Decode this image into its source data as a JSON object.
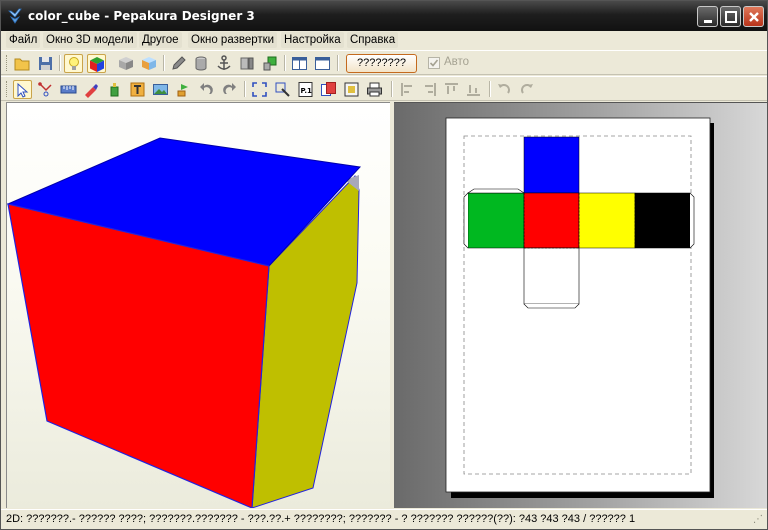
{
  "window": {
    "title": "color_cube - Pepakura Designer 3",
    "app_icon": "pepakura-logo-icon"
  },
  "menu": [
    {
      "label": "Файл"
    },
    {
      "label": "Окно 3D модели"
    },
    {
      "label": "Другое"
    },
    {
      "label": "Окно развертки"
    },
    {
      "label": "Настройка"
    },
    {
      "label": "Справка"
    }
  ],
  "toolbar1": {
    "text_button_label": "????????",
    "auto_label": "Авто",
    "auto_checked": true
  },
  "cube_colors": {
    "top": "#0000ff",
    "front": "#ff0000",
    "side": "#bfbf00"
  },
  "unfold_faces": [
    {
      "color": "#0000ff"
    },
    {
      "color": "#00b820"
    },
    {
      "color": "#ff0000"
    },
    {
      "color": "#ffff00"
    },
    {
      "color": "#000000"
    },
    {
      "color": "#ffffff"
    }
  ],
  "statusbar": {
    "text": "2D: ???????.- ?????? ????; ???????.??????? - ???.??.+ ????????; ??????? - ? ??????? ??????(??): ?43 ?43 ?43 / ?????? 1"
  }
}
